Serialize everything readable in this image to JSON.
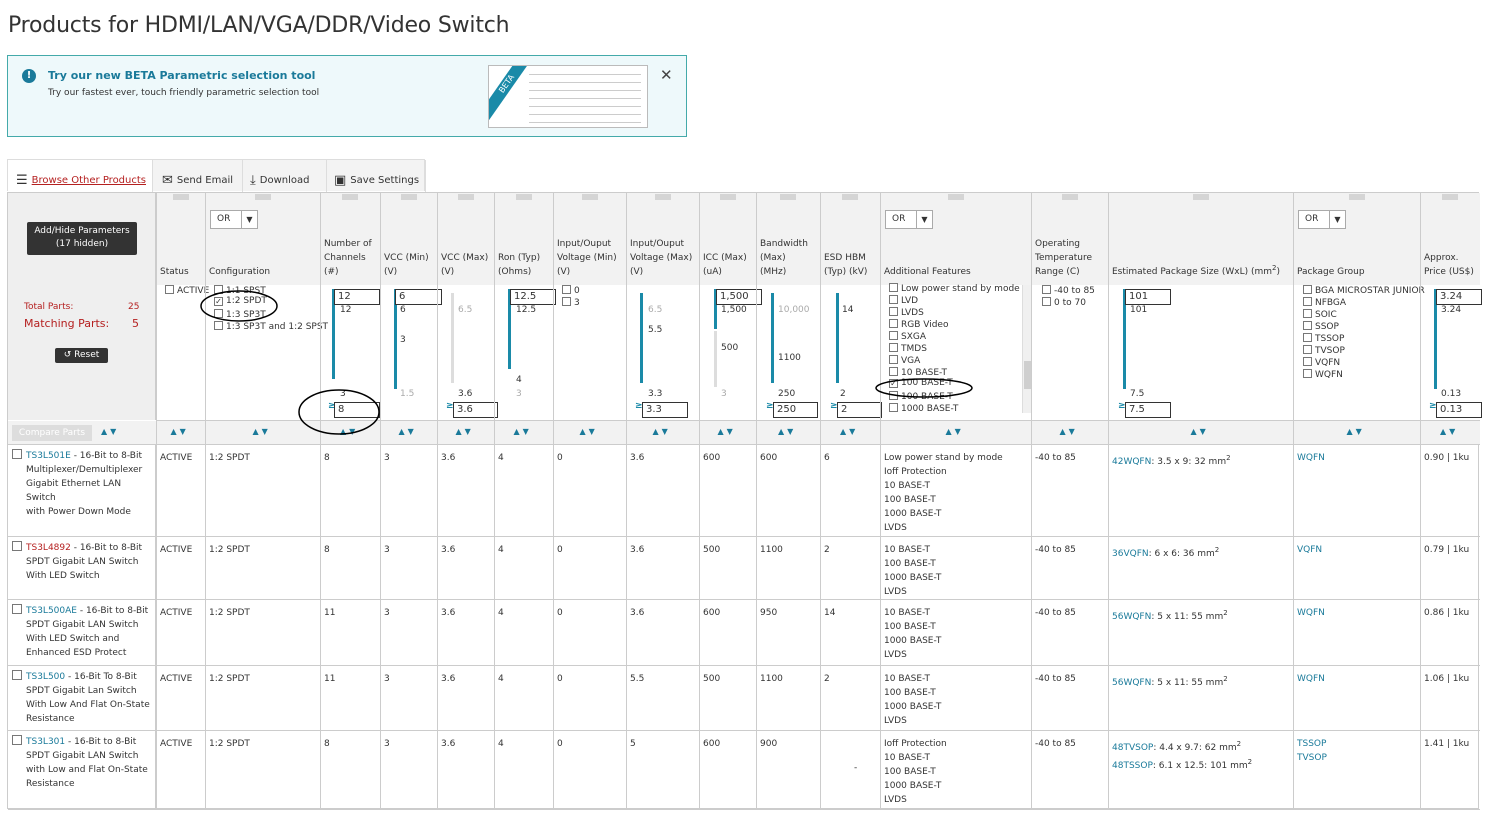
{
  "page": {
    "title": "Products for HDMI/LAN/VGA/DDR/Video Switch"
  },
  "beta": {
    "heading": "Try our new BETA Parametric selection tool",
    "text": "Try our fastest ever, touch friendly parametric selection tool",
    "ribbon": "BETA",
    "close": "✕"
  },
  "tabs": {
    "browse": "Browse Other Products",
    "email": "Send Email",
    "download": "Download",
    "save": "Save Settings"
  },
  "left": {
    "add_hide_1": "Add/Hide Parameters",
    "add_hide_2": "(17 hidden)",
    "total_label": "Total Parts:",
    "total_value": "25",
    "matching_label": "Matching Parts:",
    "matching_value": "5",
    "reset": "Reset",
    "compare": "Compare Parts"
  },
  "columns": {
    "status": "Status",
    "config": "Configuration",
    "channels_1": "Number of",
    "channels_2": "Channels",
    "channels_3": "(#)",
    "vccmin_1": "VCC (Min)",
    "vccmin_2": "(V)",
    "vccmax_1": "VCC (Max)",
    "vccmax_2": "(V)",
    "ron_1": "Ron (Typ)",
    "ron_2": "(Ohms)",
    "iomin_1": "Input/Ouput",
    "iomin_2": "Voltage (Min)",
    "iomin_3": "(V)",
    "iomax_1": "Input/Ouput",
    "iomax_2": "Voltage (Max)",
    "iomax_3": "(V)",
    "icc_1": "ICC (Max)",
    "icc_2": "(uA)",
    "bw_1": "Bandwidth",
    "bw_2": "(Max)",
    "bw_3": "(MHz)",
    "esd_1": "ESD HBM",
    "esd_2": "(Typ) (kV)",
    "features": "Additional Features",
    "temp_1": "Operating",
    "temp_2": "Temperature",
    "temp_3": "Range (C)",
    "pkgsize": "Estimated Package Size (WxL) (mm",
    "pkgsize_sup": "2",
    "pkgsize_end": ")",
    "pkggroup": "Package Group",
    "price_1": "Approx.",
    "price_2": "Price (US$)",
    "or": "OR"
  },
  "filters": {
    "status": [
      "ACTIVE"
    ],
    "config": [
      "1:1 SPST",
      "1:2 SPDT",
      "1:3 SP3T",
      "1:3 SP3T and 1:2 SPST"
    ],
    "channels": {
      "top": "12",
      "top_label": "12",
      "bottom_label": "3",
      "box_top": "12",
      "box_bottom": "8"
    },
    "vccmin": {
      "top": "6",
      "top_label": "6",
      "mid_label": "3",
      "bottom_label": "1.5"
    },
    "vccmax": {
      "top_label": "6.5",
      "bottom_label": "3.6",
      "box_bottom": "3.6"
    },
    "ron": {
      "box_top": "12.5",
      "top_label": "12.5",
      "mid_label": "4",
      "bottom_label": "3"
    },
    "iomin": [
      "0",
      "3"
    ],
    "iomax": {
      "top_label": "6.5",
      "mid_label": "5.5",
      "bottom_label": "3.3",
      "box_bottom": "3.3"
    },
    "icc": {
      "box_top": "1,500",
      "top_label": "1,500",
      "mid_label": "500",
      "bottom_label": "3"
    },
    "bw": {
      "top_label": "10,000",
      "mid_label": "1100",
      "bottom_label": "250",
      "box_bottom": "250"
    },
    "esd": {
      "top_label": "14",
      "bottom_label": "2",
      "box_bottom": "2"
    },
    "features": [
      "Low power stand by mode",
      "LVD",
      "LVDS",
      "RGB Video",
      "SXGA",
      "TMDS",
      "VGA",
      "10 BASE-T",
      "100 BASE-T",
      "100 BASE-T",
      "1000 BASE-T"
    ],
    "temp": [
      "-40 to 85",
      "0 to 70"
    ],
    "pkgsize": {
      "box_top": "101",
      "top_label": "101",
      "bottom_label": "7.5",
      "box_bottom": "7.5"
    },
    "pkggroup": [
      "BGA MICROSTAR JUNIOR",
      "NFBGA",
      "SOIC",
      "SSOP",
      "TSSOP",
      "TVSOP",
      "VQFN",
      "WQFN"
    ],
    "price": {
      "box_top": "3.24",
      "top_label": "3.24",
      "bottom_label": "0.13",
      "box_bottom": "0.13"
    }
  },
  "rows": [
    {
      "part": "TS3L501E",
      "desc": " - 16-Bit to 8-Bit Multiplexer/Demultiplexer Gigabit Ethernet LAN Switch with Power Down Mode",
      "desc_lines": [
        "TS3L501E - 16-Bit to 8-Bit",
        "Multiplexer/Demultiplexer",
        "Gigabit Ethernet LAN Switch",
        "with Power Down Mode"
      ],
      "status": "ACTIVE",
      "config": "1:2 SPDT",
      "channels": "8",
      "vccmin": "3",
      "vccmax": "3.6",
      "ron": "4",
      "iomin": "0",
      "iomax": "3.6",
      "icc": "600",
      "bw": "600",
      "esd": "6",
      "features": [
        "Low power stand by mode",
        "Ioff Protection",
        "10 BASE-T",
        "100 BASE-T",
        "1000 BASE-T",
        "LVDS"
      ],
      "temp": "-40 to 85",
      "pkg": [
        {
          "name": "42WQFN",
          "size": ": 3.5 x 9: 32 mm"
        }
      ],
      "group": [
        "WQFN"
      ],
      "price": "0.90 | 1ku"
    },
    {
      "part": "TS3L4892",
      "desc_lines": [
        "TS3L4892 - 16-Bit to 8-Bit",
        "SPDT Gigabit LAN Switch",
        "With LED Switch"
      ],
      "status": "ACTIVE",
      "config": "1:2 SPDT",
      "channels": "8",
      "vccmin": "3",
      "vccmax": "3.6",
      "ron": "4",
      "iomin": "0",
      "iomax": "3.6",
      "icc": "500",
      "bw": "1100",
      "esd": "2",
      "features": [
        "10 BASE-T",
        "100 BASE-T",
        "1000 BASE-T",
        "LVDS"
      ],
      "temp": "-40 to 85",
      "pkg": [
        {
          "name": "36VQFN",
          "size": ": 6 x 6: 36 mm"
        }
      ],
      "group": [
        "VQFN"
      ],
      "price": "0.79 | 1ku"
    },
    {
      "part": "TS3L500AE",
      "desc_lines": [
        "TS3L500AE - 16-Bit to 8-Bit",
        "SPDT Gigabit LAN Switch",
        "With LED Switch and",
        "Enhanced ESD Protect"
      ],
      "status": "ACTIVE",
      "config": "1:2 SPDT",
      "channels": "11",
      "vccmin": "3",
      "vccmax": "3.6",
      "ron": "4",
      "iomin": "0",
      "iomax": "3.6",
      "icc": "600",
      "bw": "950",
      "esd": "14",
      "features": [
        "10 BASE-T",
        "100 BASE-T",
        "1000 BASE-T",
        "LVDS"
      ],
      "temp": "-40 to 85",
      "pkg": [
        {
          "name": "56WQFN",
          "size": ": 5 x 11: 55 mm"
        }
      ],
      "group": [
        "WQFN"
      ],
      "price": "0.86 | 1ku"
    },
    {
      "part": "TS3L500",
      "desc_lines": [
        "TS3L500 - 16-Bit To 8-Bit",
        "SPDT Gigabit Lan Switch",
        "With Low And Flat On-State",
        "Resistance"
      ],
      "status": "ACTIVE",
      "config": "1:2 SPDT",
      "channels": "11",
      "vccmin": "3",
      "vccmax": "3.6",
      "ron": "4",
      "iomin": "0",
      "iomax": "5.5",
      "icc": "500",
      "bw": "1100",
      "esd": "2",
      "features": [
        "10 BASE-T",
        "100 BASE-T",
        "1000 BASE-T",
        "LVDS"
      ],
      "temp": "-40 to 85",
      "pkg": [
        {
          "name": "56WQFN",
          "size": ": 5 x 11: 55 mm"
        }
      ],
      "group": [
        "WQFN"
      ],
      "price": "1.06 | 1ku"
    },
    {
      "part": "TS3L301",
      "desc_lines": [
        "TS3L301 - 16-Bit to 8-Bit",
        "SPDT Gigabit LAN Switch",
        "with Low and Flat On-State",
        "Resistance"
      ],
      "status": "ACTIVE",
      "config": "1:2 SPDT",
      "channels": "8",
      "vccmin": "3",
      "vccmax": "3.6",
      "ron": "4",
      "iomin": "0",
      "iomax": "5",
      "icc": "600",
      "bw": "900",
      "esd": "-",
      "features": [
        "Ioff Protection",
        "10 BASE-T",
        "100 BASE-T",
        "1000 BASE-T",
        "LVDS"
      ],
      "temp": "-40 to 85",
      "pkg": [
        {
          "name": "48TVSOP",
          "size": ": 4.4 x 9.7: 62 mm"
        },
        {
          "name": "48TSSOP",
          "size": ": 6.1 x 12.5: 101 mm"
        }
      ],
      "group": [
        "TSSOP",
        "TVSOP"
      ],
      "price": "1.41 | 1ku"
    }
  ]
}
